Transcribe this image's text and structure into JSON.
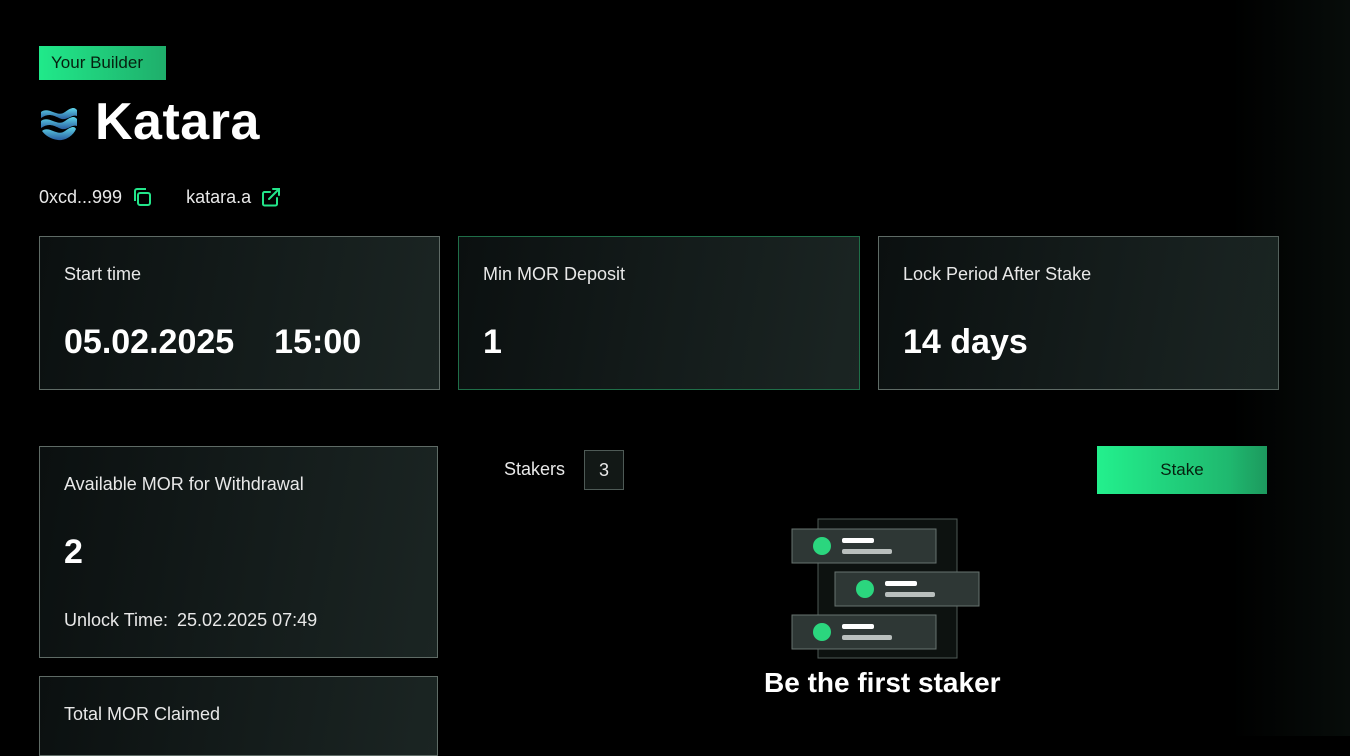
{
  "badge": "Your Builder",
  "builder": {
    "name": "Katara",
    "address": "0xcd...999",
    "link": "katara.a",
    "logo_icon": "wave-logo-icon",
    "copy_icon": "copy-icon",
    "external_icon": "external-link-icon"
  },
  "stats": {
    "start_time": {
      "label": "Start time",
      "date": "05.02.2025",
      "time": "15:00"
    },
    "min_deposit": {
      "label": "Min MOR Deposit",
      "value": "1"
    },
    "lock_period": {
      "label": "Lock Period After Stake",
      "value": "14 days"
    }
  },
  "withdrawal": {
    "label": "Available MOR for Withdrawal",
    "value": "2",
    "unlock_label": "Unlock Time:",
    "unlock_value": "25.02.2025 07:49"
  },
  "claimed": {
    "label": "Total MOR Claimed"
  },
  "stakers": {
    "label": "Stakers",
    "count": "3"
  },
  "stake_button": "Stake",
  "empty_state": "Be the first staker",
  "colors": {
    "accent": "#23f08d",
    "accent_dark": "#1ea866",
    "background": "#000000",
    "card_border": "#5f6b66"
  }
}
